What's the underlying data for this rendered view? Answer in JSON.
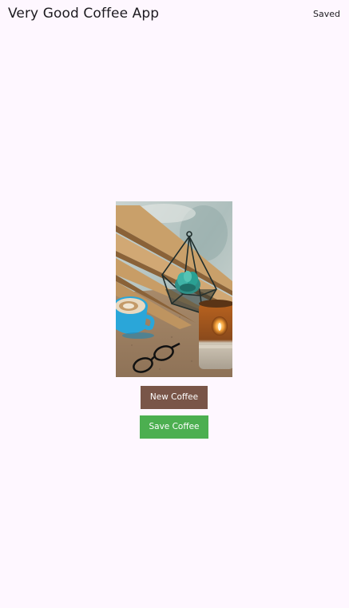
{
  "appbar": {
    "title": "Very Good Coffee App",
    "saved_label": "Saved"
  },
  "main": {
    "image_description_icon": "coffee-photo",
    "new_button_label": "New Coffee",
    "save_button_label": "Save Coffee"
  },
  "colors": {
    "background": "#fef7ff",
    "new_button": "#795548",
    "save_button": "#4caf50",
    "text": "#1d1b20"
  }
}
